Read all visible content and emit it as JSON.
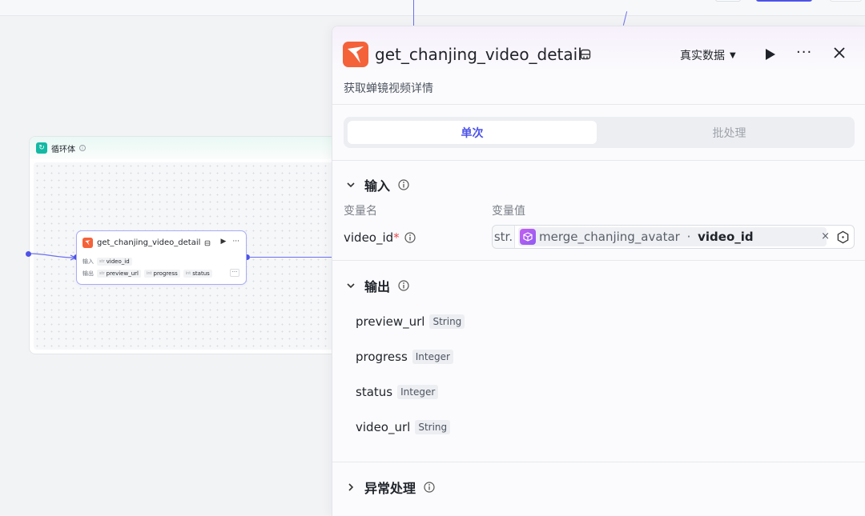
{
  "canvas": {
    "loop": {
      "title": "循环体",
      "info_icon": "info-icon"
    },
    "node": {
      "title": "get_chanjing_video_detail",
      "input_label": "输入",
      "output_label": "输出",
      "input_chip": {
        "type": "str",
        "name": "video_id"
      },
      "output_chips": [
        {
          "type": "str",
          "name": "preview_url"
        },
        {
          "type": "int",
          "name": "progress"
        },
        {
          "type": "int",
          "name": "status"
        }
      ],
      "more_label": "···"
    }
  },
  "panel": {
    "title": "get_chanjing_video_detail",
    "description": "获取蝉镜视频详情",
    "mode_label": "真实数据",
    "more_label": "···",
    "tabs": [
      {
        "label": "单次",
        "active": true
      },
      {
        "label": "批处理",
        "active": false
      }
    ],
    "input_section": {
      "title": "输入",
      "col_name": "变量名",
      "col_value": "变量值",
      "field": {
        "name": "video_id",
        "required_mark": "*",
        "type_tag": "str.",
        "ref_source": "merge_chanjing_avatar",
        "ref_sep": " · ",
        "ref_var": "video_id",
        "clear": "×"
      }
    },
    "output_section": {
      "title": "输出",
      "items": [
        {
          "name": "preview_url",
          "type": "String"
        },
        {
          "name": "progress",
          "type": "Integer"
        },
        {
          "name": "status",
          "type": "Integer"
        },
        {
          "name": "video_url",
          "type": "String"
        }
      ]
    },
    "error_section": {
      "title": "异常处理"
    }
  },
  "colors": {
    "accent": "#4d53e8",
    "loop_icon": "#13b9a4",
    "required": "#e5484d",
    "plugin_logo": "#f4623a",
    "ref_icon": "#b05ef2"
  }
}
